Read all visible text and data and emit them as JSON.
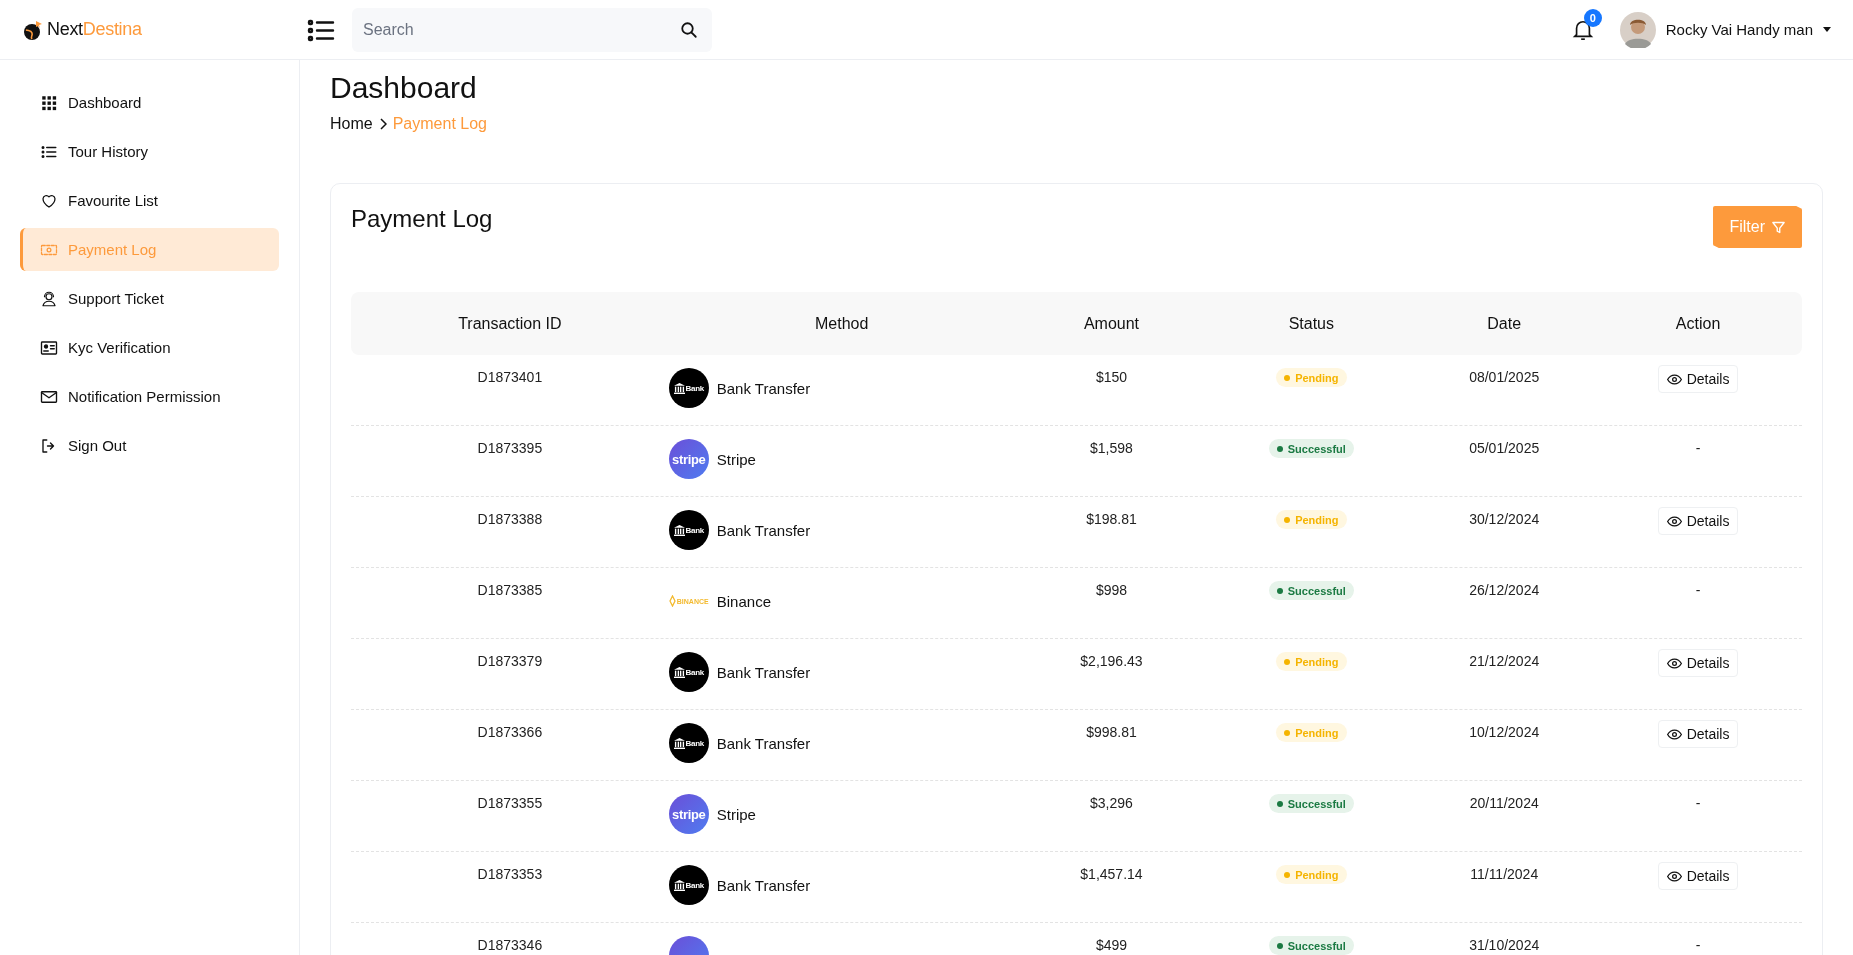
{
  "brand": {
    "first": "Next",
    "second": "Destina"
  },
  "search": {
    "placeholder": "Search"
  },
  "notifications": {
    "count": "0"
  },
  "user": {
    "name": "Rocky Vai Handy man"
  },
  "sidebar": {
    "items": [
      {
        "label": "Dashboard",
        "selected": false
      },
      {
        "label": "Tour History",
        "selected": false
      },
      {
        "label": "Favourite List",
        "selected": false
      },
      {
        "label": "Payment Log",
        "selected": true
      },
      {
        "label": "Support Ticket",
        "selected": false
      },
      {
        "label": "Kyc Verification",
        "selected": false
      },
      {
        "label": "Notification Permission",
        "selected": false
      },
      {
        "label": "Sign Out",
        "selected": false
      }
    ]
  },
  "page_title": "Dashboard",
  "breadcrumb": [
    {
      "label": "Home",
      "current": false
    },
    {
      "label": "Payment Log",
      "current": true
    }
  ],
  "card": {
    "title": "Payment Log",
    "filter_button": "Filter"
  },
  "table": {
    "columns": [
      "Transaction ID",
      "Method",
      "Amount",
      "Status",
      "Date",
      "Action"
    ],
    "rows": [
      {
        "id": "D1873401",
        "method": {
          "kind": "bank",
          "logo_text": "Bank",
          "name": "Bank Transfer"
        },
        "amount": "$150",
        "status": {
          "kind": "pending",
          "label": "Pending"
        },
        "date": "08/01/2025",
        "action": {
          "kind": "details",
          "label": "Details"
        }
      },
      {
        "id": "D1873395",
        "method": {
          "kind": "stripe",
          "logo_text": "stripe",
          "name": "Stripe"
        },
        "amount": "$1,598",
        "status": {
          "kind": "successful",
          "label": "Successful"
        },
        "date": "05/01/2025",
        "action": {
          "kind": "none",
          "label": "-"
        }
      },
      {
        "id": "D1873388",
        "method": {
          "kind": "bank",
          "logo_text": "Bank",
          "name": "Bank Transfer"
        },
        "amount": "$198.81",
        "status": {
          "kind": "pending",
          "label": "Pending"
        },
        "date": "30/12/2024",
        "action": {
          "kind": "details",
          "label": "Details"
        }
      },
      {
        "id": "D1873385",
        "method": {
          "kind": "binance",
          "logo_text": "BINANCE",
          "name": "Binance"
        },
        "amount": "$998",
        "status": {
          "kind": "successful",
          "label": "Successful"
        },
        "date": "26/12/2024",
        "action": {
          "kind": "none",
          "label": "-"
        }
      },
      {
        "id": "D1873379",
        "method": {
          "kind": "bank",
          "logo_text": "Bank",
          "name": "Bank Transfer"
        },
        "amount": "$2,196.43",
        "status": {
          "kind": "pending",
          "label": "Pending"
        },
        "date": "21/12/2024",
        "action": {
          "kind": "details",
          "label": "Details"
        }
      },
      {
        "id": "D1873366",
        "method": {
          "kind": "bank",
          "logo_text": "Bank",
          "name": "Bank Transfer"
        },
        "amount": "$998.81",
        "status": {
          "kind": "pending",
          "label": "Pending"
        },
        "date": "10/12/2024",
        "action": {
          "kind": "details",
          "label": "Details"
        }
      },
      {
        "id": "D1873355",
        "method": {
          "kind": "stripe",
          "logo_text": "stripe",
          "name": "Stripe"
        },
        "amount": "$3,296",
        "status": {
          "kind": "successful",
          "label": "Successful"
        },
        "date": "20/11/2024",
        "action": {
          "kind": "none",
          "label": "-"
        }
      },
      {
        "id": "D1873353",
        "method": {
          "kind": "bank",
          "logo_text": "Bank",
          "name": "Bank Transfer"
        },
        "amount": "$1,457.14",
        "status": {
          "kind": "pending",
          "label": "Pending"
        },
        "date": "11/11/2024",
        "action": {
          "kind": "details",
          "label": "Details"
        }
      },
      {
        "id": "D1873346",
        "method": {
          "kind": "stripe"
        },
        "amount": "$499",
        "status": {
          "kind": "successful",
          "label": "Successful"
        },
        "date": "31/10/2024",
        "action": {
          "kind": "none",
          "label": "-"
        }
      }
    ]
  }
}
